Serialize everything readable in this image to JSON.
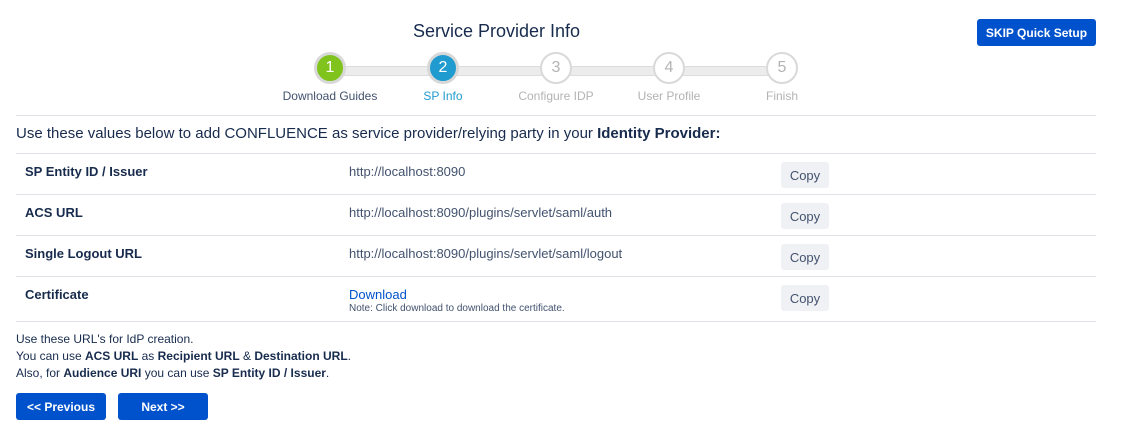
{
  "header": {
    "title": "Service Provider Info",
    "skip_label": "SKIP Quick Setup"
  },
  "stepper": {
    "steps": [
      {
        "number": "1",
        "label": "Download Guides",
        "state": "done"
      },
      {
        "number": "2",
        "label": "SP Info",
        "state": "active"
      },
      {
        "number": "3",
        "label": "Configure IDP",
        "state": "pending"
      },
      {
        "number": "4",
        "label": "User Profile",
        "state": "pending"
      },
      {
        "number": "5",
        "label": "Finish",
        "state": "pending"
      }
    ]
  },
  "intro": {
    "text_before": "Use these values below to add CONFLUENCE as service provider/relying party in your ",
    "text_bold": "Identity Provider:"
  },
  "table": {
    "copy_label": "Copy",
    "rows": [
      {
        "label": "SP Entity ID / Issuer",
        "value": "http://localhost:8090"
      },
      {
        "label": "ACS URL",
        "value": "http://localhost:8090/plugins/servlet/saml/auth"
      },
      {
        "label": "Single Logout URL",
        "value": "http://localhost:8090/plugins/servlet/saml/logout"
      },
      {
        "label": "Certificate",
        "link": "Download",
        "note": "Note: Click download to download the certificate."
      }
    ]
  },
  "notes": {
    "line1": "Use these URL's for IdP creation.",
    "line2_a": "You can use ",
    "line2_b": "ACS URL",
    "line2_c": " as ",
    "line2_d": "Recipient URL",
    "line2_e": " & ",
    "line2_f": "Destination URL",
    "line2_g": ".",
    "line3_a": "Also, for ",
    "line3_b": "Audience URI",
    "line3_c": " you can use ",
    "line3_d": "SP Entity ID / Issuer",
    "line3_e": "."
  },
  "nav": {
    "previous_label": "<< Previous",
    "next_label": "Next >>"
  },
  "colors": {
    "primary": "#0052cc",
    "step_done": "#80c31c",
    "step_active": "#1f9bcf"
  }
}
